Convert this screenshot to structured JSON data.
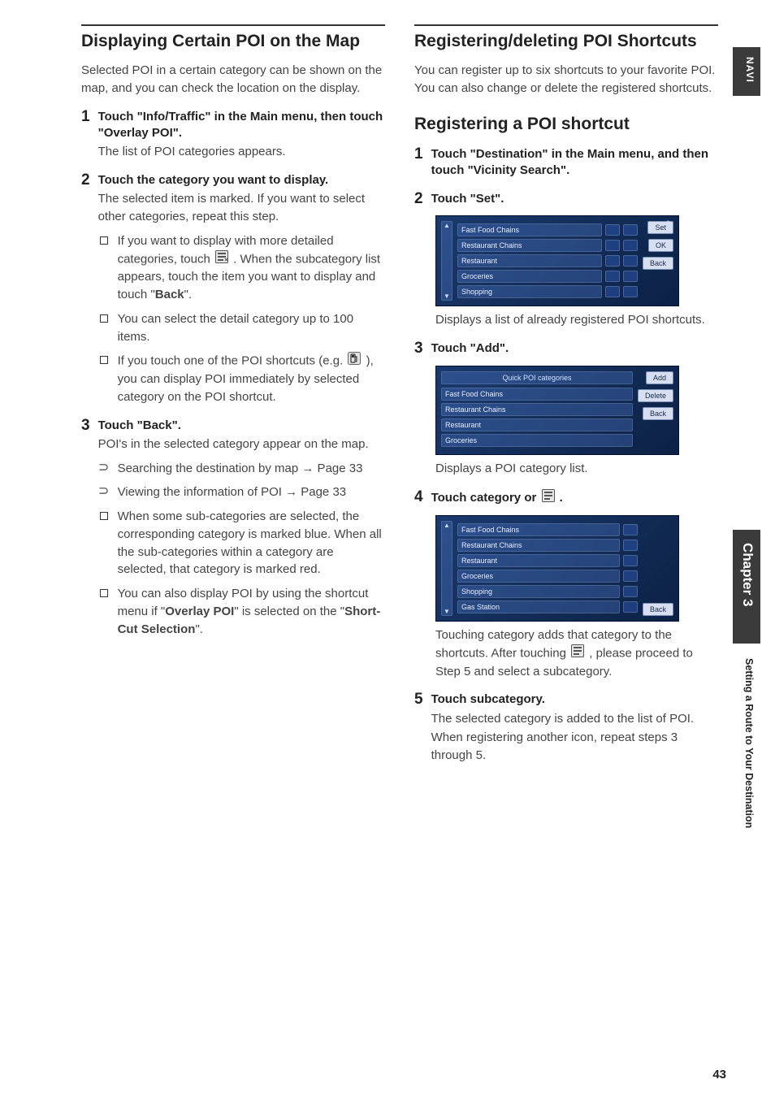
{
  "nav": {
    "side_label": "NAVI",
    "chapter": "Chapter 3",
    "chapter_sub": "Setting a Route to Your Destination",
    "page_number": "43"
  },
  "left": {
    "title": "Displaying Certain POI on the Map",
    "intro": "Selected POI in a certain category can be shown on the map, and you can check the location on the display.",
    "steps": [
      {
        "num": "1",
        "instr": "Touch \"Info/Traffic\" in the Main menu, then touch \"Overlay POI\".",
        "note": "The list of POI categories appears."
      },
      {
        "num": "2",
        "instr": "Touch the category you want to display.",
        "note": "The selected item is marked. If you want to select other categories, repeat this step.",
        "bullets": [
          {
            "t": "sq",
            "pre": "If you want to display with more detailed categories, touch ",
            "post": ". When the subcategory list appears, touch the item you want to display and touch \"",
            "bold": "Back",
            "tail": "\"."
          },
          {
            "t": "sq",
            "text": "You can select the detail category up to 100 items."
          },
          {
            "t": "sq",
            "pre": "If you touch one of the POI shortcuts (e.g. ",
            "post": "), you can display POI immediately by selected category on the POI shortcut."
          }
        ]
      },
      {
        "num": "3",
        "instr": "Touch \"Back\".",
        "note": "POI's in the selected category appear on the map.",
        "bullets": [
          {
            "t": "arc",
            "pre": "Searching the destination by map ",
            "arrow": "→",
            "post": " Page 33"
          },
          {
            "t": "arc",
            "pre": "Viewing the information of POI ",
            "arrow": "→",
            "post": " Page 33"
          },
          {
            "t": "sq",
            "text": "When some sub-categories are selected, the corresponding category is marked blue. When all the sub-categories within a category are selected, that category is marked red."
          },
          {
            "t": "sq",
            "pre": "You can also display POI by using the shortcut menu if \"",
            "b1": "Overlay POI",
            "mid": "\" is selected on the \"",
            "b2": "Short-Cut Selection",
            "tail": "\"."
          }
        ]
      }
    ]
  },
  "right": {
    "title": "Registering/deleting POI Shortcuts",
    "intro": "You can register up to six shortcuts to your favorite POI. You can also change or delete the registered shortcuts.",
    "subhead": "Registering a POI shortcut",
    "steps": [
      {
        "num": "1",
        "instr": "Touch \"Destination\" in the Main menu, and then touch \"Vicinity Search\"."
      },
      {
        "num": "2",
        "instr": "Touch \"Set\".",
        "after": "Displays a list of already registered POI shortcuts."
      },
      {
        "num": "3",
        "instr": "Touch \"Add\".",
        "after": "Displays a POI category list."
      },
      {
        "num": "4",
        "instr_pre": "Touch category or ",
        "instr_post": ".",
        "after_pre": "Touching category adds that category to the shortcuts. After touching ",
        "after_post": ", please proceed to Step 5 and select a subcategory."
      },
      {
        "num": "5",
        "instr": "Touch subcategory.",
        "note": "The selected category is added to the list of POI.",
        "note2": "When registering another icon, repeat steps 3 through 5."
      }
    ],
    "shot1": {
      "count": "0",
      "rows": [
        "Fast Food Chains",
        "Restaurant Chains",
        "Restaurant",
        "Groceries",
        "Shopping"
      ],
      "btns": [
        "Set",
        "OK",
        "Back"
      ]
    },
    "shot2": {
      "header": "Quick POI categories",
      "rows": [
        "Fast Food Chains",
        "Restaurant Chains",
        "Restaurant",
        "Groceries"
      ],
      "btns": [
        "Add",
        "Delete",
        "Back"
      ]
    },
    "shot3": {
      "rows": [
        "Fast Food Chains",
        "Restaurant Chains",
        "Restaurant",
        "Groceries",
        "Shopping",
        "Gas Station"
      ],
      "btns": [
        "Back"
      ]
    }
  }
}
